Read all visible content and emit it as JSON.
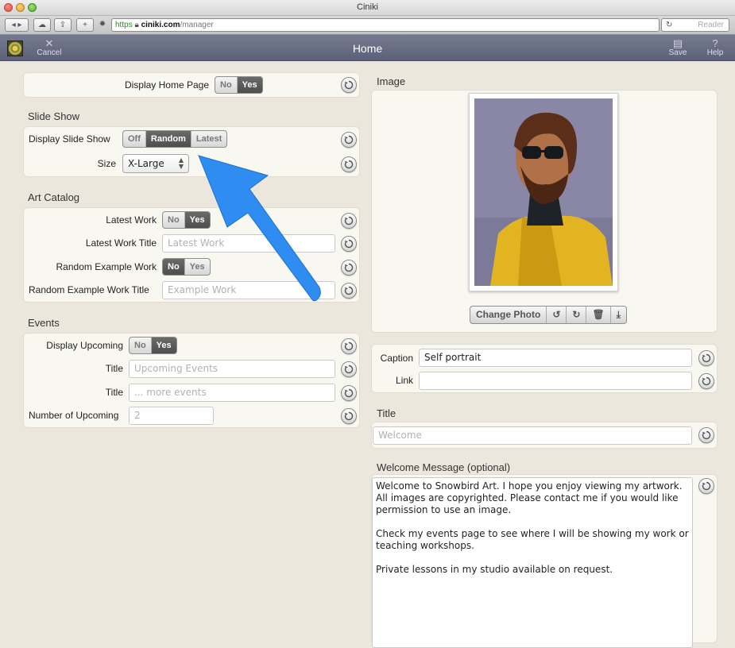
{
  "browser": {
    "window_title": "Ciniki",
    "url_scheme": "https",
    "url_domain": "ciniki.com",
    "url_path": "/manager",
    "reader_label": "Reader"
  },
  "header": {
    "title": "Home",
    "cancel_label": "Cancel",
    "save_label": "Save",
    "help_label": "Help"
  },
  "home": {
    "display_label": "Display Home Page",
    "options": [
      "No",
      "Yes"
    ],
    "selected": "Yes"
  },
  "slideshow": {
    "heading": "Slide Show",
    "display_label": "Display Slide Show",
    "options": [
      "Off",
      "Random",
      "Latest"
    ],
    "selected": "Random",
    "size_label": "Size",
    "size_value": "X-Large"
  },
  "art_catalog": {
    "heading": "Art Catalog",
    "latest_label": "Latest Work",
    "latest_options": [
      "No",
      "Yes"
    ],
    "latest_selected": "Yes",
    "latest_title_label": "Latest Work Title",
    "latest_title_placeholder": "Latest Work",
    "random_label": "Random Example Work",
    "random_options": [
      "No",
      "Yes"
    ],
    "random_selected": "No",
    "random_title_label": "Random Example Work Title",
    "random_title_placeholder": "Example Work"
  },
  "events": {
    "heading": "Events",
    "display_label": "Display Upcoming",
    "options": [
      "No",
      "Yes"
    ],
    "selected": "Yes",
    "title1_label": "Title",
    "title1_placeholder": "Upcoming Events",
    "title2_label": "Title",
    "title2_placeholder": "... more events",
    "number_label": "Number of Upcoming",
    "number_placeholder": "2"
  },
  "image": {
    "heading": "Image",
    "change_photo_label": "Change Photo",
    "tool_icons": [
      "rotate-left-icon",
      "rotate-right-icon",
      "trash-icon",
      "download-icon"
    ]
  },
  "caption": {
    "caption_label": "Caption",
    "caption_value": "Self portrait",
    "link_label": "Link",
    "link_value": ""
  },
  "title": {
    "heading": "Title",
    "placeholder": "Welcome"
  },
  "welcome": {
    "heading": "Welcome Message (optional)",
    "text": "Welcome to Snowbird Art. I hope you enjoy viewing my artwork.\nAll images are copyrighted. Please contact me if you would like\npermission to use an image.\n\nCheck my events page to see where I will be showing my work or\nteaching workshops.\n\nPrivate lessons in my studio available on request."
  },
  "colors": {
    "header_bg": "#6a6f85",
    "segment_on": "#555555",
    "annotation_arrow": "#2f8cf0"
  }
}
